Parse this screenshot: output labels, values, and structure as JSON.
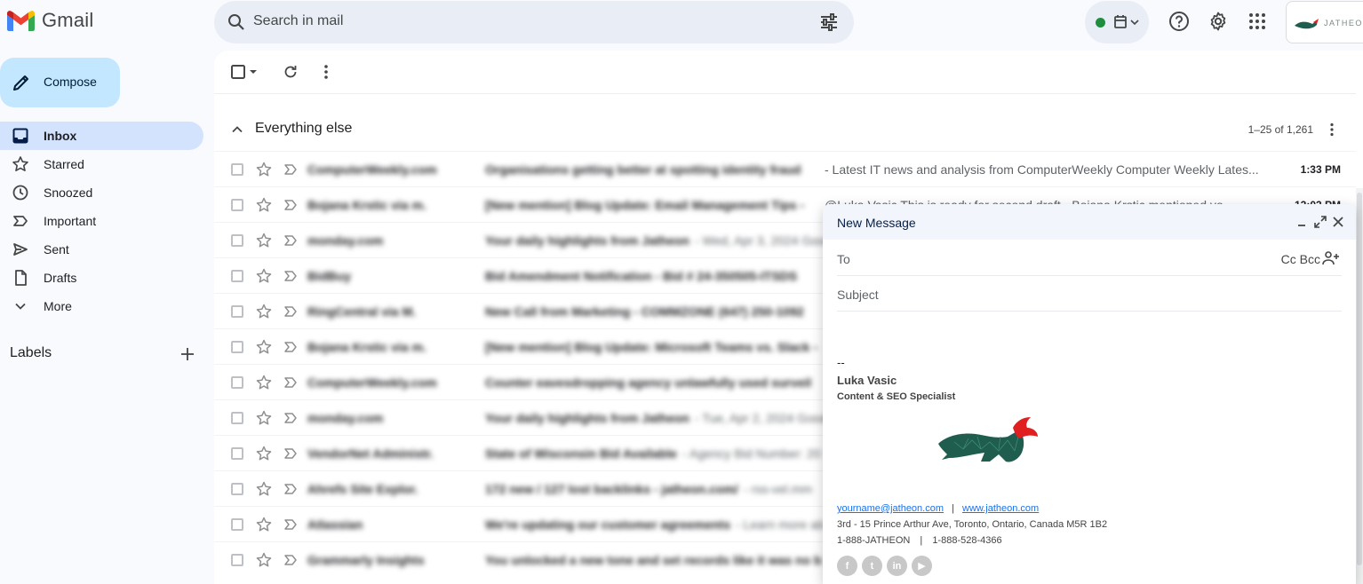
{
  "app": {
    "name": "Gmail"
  },
  "search": {
    "placeholder": "Search in mail"
  },
  "sidebar": {
    "compose_label": "Compose",
    "items": [
      {
        "label": "Inbox",
        "icon": "inbox-icon",
        "active": true
      },
      {
        "label": "Starred",
        "icon": "star-icon"
      },
      {
        "label": "Snoozed",
        "icon": "clock-icon"
      },
      {
        "label": "Important",
        "icon": "important-icon"
      },
      {
        "label": "Sent",
        "icon": "send-icon"
      },
      {
        "label": "Drafts",
        "icon": "draft-icon"
      },
      {
        "label": "More",
        "icon": "chevron-down-icon"
      }
    ],
    "labels_title": "Labels"
  },
  "section": {
    "title": "Everything else",
    "count": "1–25 of 1,261"
  },
  "emails": [
    {
      "sender": "ComputerWeekly.com",
      "subject": "Organisations getting better at spotting identity fraud",
      "snippet": "- Latest IT news and analysis from ComputerWeekly Computer Weekly Lates...",
      "time": "1:33 PM",
      "snippet_blurred": false
    },
    {
      "sender": "Bojana Krstic via m.",
      "subject": "[New mention] Blog Update: Email Management Tips -",
      "snippet": "@Luka Vasic This is ready for second draft - Bojana Krstic mentioned yo...",
      "time": "12:03 PM",
      "snippet_blurred": false
    },
    {
      "sender": "monday.com",
      "subject": "Your daily highlights from Jatheon",
      "snippet": "- Wed, Apr 3, 2024 Good",
      "time": "",
      "snippet_blurred": true
    },
    {
      "sender": "BidBuy",
      "subject": "Bid Amendment Notification - Bid # 24-350505-ITSDS",
      "snippet": "",
      "time": "",
      "snippet_blurred": true
    },
    {
      "sender": "RingCentral via M.",
      "subject": "New Call from Marketing - COMMZONE (647) 250-1092",
      "snippet": "",
      "time": "",
      "snippet_blurred": true
    },
    {
      "sender": "Bojana Krstic via m.",
      "subject": "[New mention] Blog Update: Microsoft Teams vs. Slack -",
      "snippet": "",
      "time": "",
      "snippet_blurred": true
    },
    {
      "sender": "ComputerWeekly.com",
      "subject": "Counter eavesdropping agency unlawfully used surveil",
      "snippet": "",
      "time": "",
      "snippet_blurred": true
    },
    {
      "sender": "monday.com",
      "subject": "Your daily highlights from Jatheon",
      "snippet": "- Tue, Apr 2, 2024 Good",
      "time": "",
      "snippet_blurred": true
    },
    {
      "sender": "VendorNet Administr.",
      "subject": "State of Wisconsin Bid Available",
      "snippet": "- Agency Bid Number: 20",
      "time": "",
      "snippet_blurred": true
    },
    {
      "sender": "Ahrefs Site Explor.",
      "subject": "172 new / 127 lost backlinks - jatheon.com/",
      "snippet": "- rss-vel.mm",
      "time": "",
      "snippet_blurred": true
    },
    {
      "sender": "Atlassian",
      "subject": "We're updating our customer agreements",
      "snippet": "- Learn more ab",
      "time": "",
      "snippet_blurred": true
    },
    {
      "sender": "Grammarly Insights",
      "subject": "You unlocked a new tone and set records like it was no b",
      "snippet": "",
      "time": "",
      "snippet_blurred": true
    }
  ],
  "compose_window": {
    "title": "New Message",
    "to_label": "To",
    "cc_bcc": "Cc Bcc",
    "subject_placeholder": "Subject",
    "signature": {
      "dash": "--",
      "name": "Luka Vasic",
      "role": "Content & SEO Specialist",
      "email": "yourname@jatheon.com",
      "sep": "|",
      "website": "www.jatheon.com",
      "address": "3rd - 15 Prince Arthur Ave, Toronto, Ontario, Canada M5R 1B2",
      "phone1": "1-888-JATHEON",
      "phone2": "1-888-528-4366",
      "social": [
        "f",
        "t",
        "in",
        "▶"
      ]
    }
  },
  "account": {
    "brand": "JATHEON"
  },
  "colors": {
    "compose_bg": "#c2e7ff",
    "active_nav": "#d3e3fd",
    "status_green": "#1e8e3e",
    "logo_green": "#1f5d4f",
    "logo_red": "#e02020"
  }
}
